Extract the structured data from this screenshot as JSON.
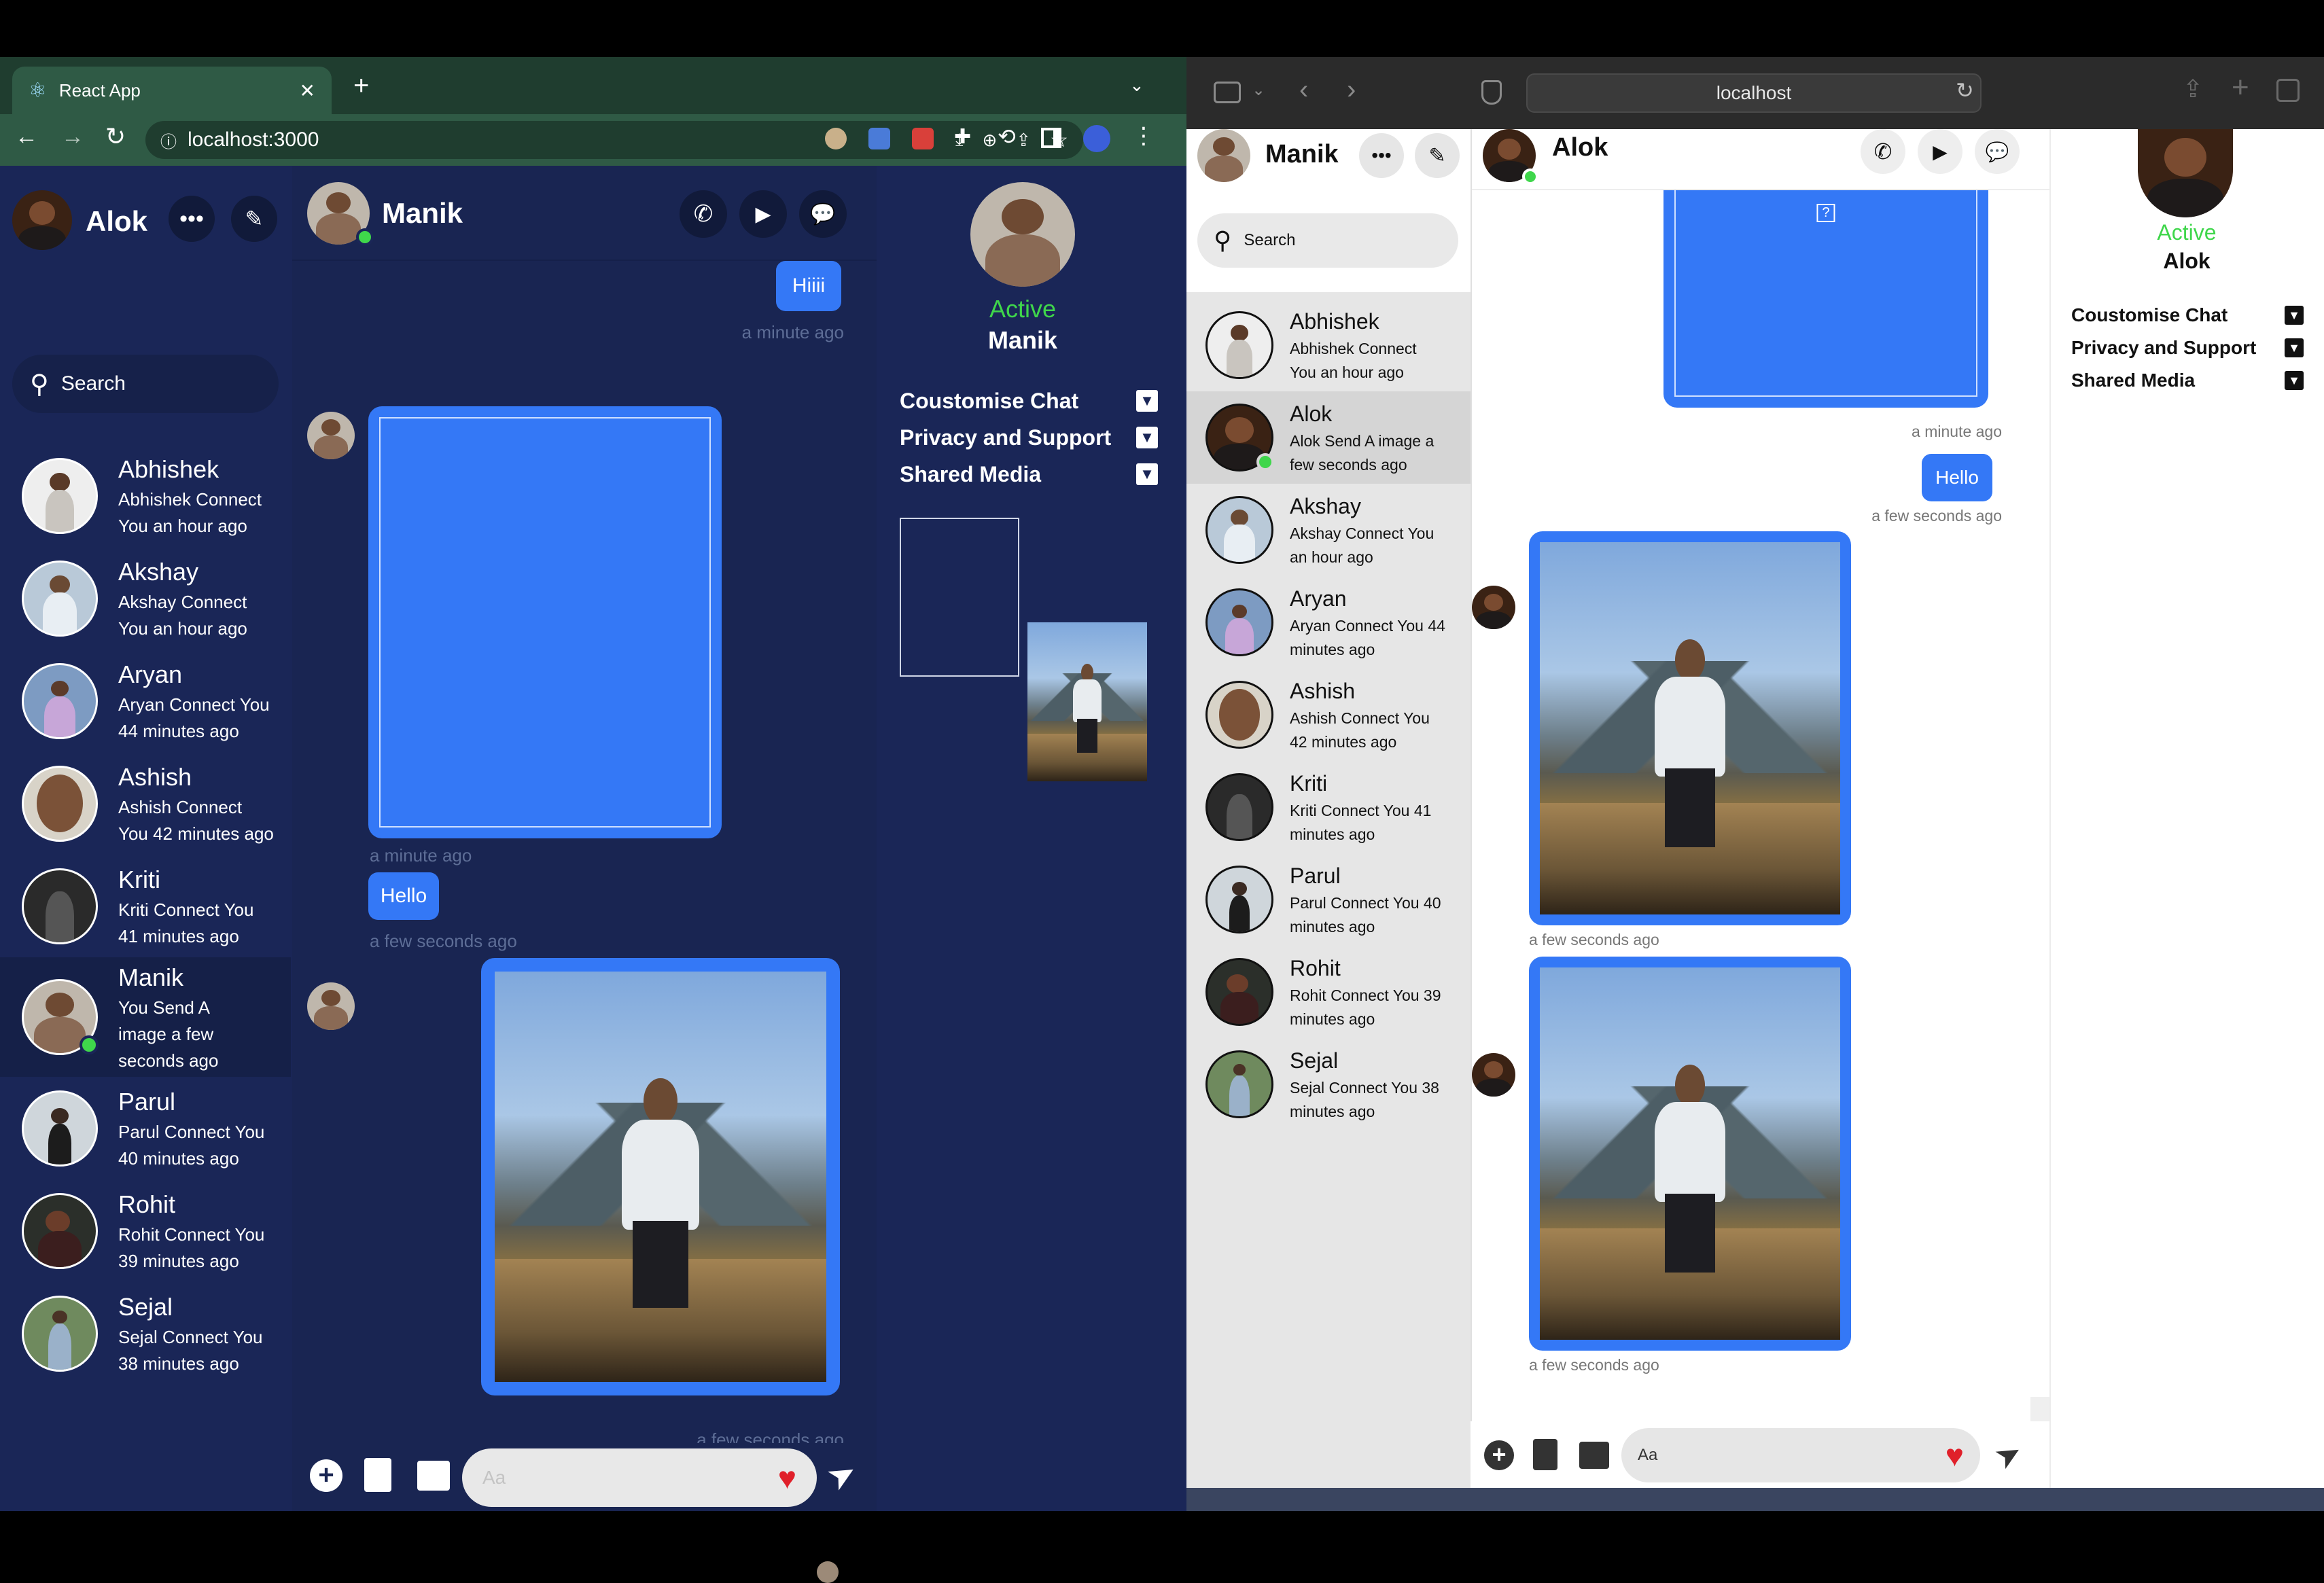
{
  "left": {
    "tab_title": "React App",
    "url": "localhost:3000",
    "user_name": "Alok",
    "search_placeholder": "Search",
    "contacts": [
      {
        "name": "Abhishek",
        "line1": "Abhishek Connect",
        "line2": "You an hour ago"
      },
      {
        "name": "Akshay",
        "line1": "Akshay Connect",
        "line2": "You an hour ago"
      },
      {
        "name": "Aryan",
        "line1": "Aryan Connect You",
        "line2": "44 minutes ago"
      },
      {
        "name": "Ashish",
        "line1": "Ashish Connect",
        "line2": "You 42 minutes ago"
      },
      {
        "name": "Kriti",
        "line1": "Kriti Connect You",
        "line2": "41 minutes ago"
      },
      {
        "name": "Manik",
        "line1": "You Send A",
        "line2": "image a few",
        "line3": "seconds ago"
      },
      {
        "name": "Parul",
        "line1": "Parul Connect You",
        "line2": "40 minutes ago"
      },
      {
        "name": "Rohit",
        "line1": "Rohit Connect You",
        "line2": "39 minutes ago"
      },
      {
        "name": "Sejal",
        "line1": "Sejal Connect You",
        "line2": "38 minutes ago"
      }
    ],
    "chat_name": "Manik",
    "messages": {
      "m1": "Hiiii",
      "t1": "a minute ago",
      "t2": "a minute ago",
      "m2": "Hello",
      "t3": "a few seconds ago",
      "t4": "a few seconds ago"
    },
    "input_placeholder": "Aa",
    "profile": {
      "status": "Active",
      "name": "Manik",
      "options": [
        "Coustomise Chat",
        "Privacy and Support",
        "Shared Media"
      ]
    }
  },
  "right": {
    "url": "localhost",
    "user_name": "Manik",
    "search_placeholder": "Search",
    "contacts": [
      {
        "name": "Abhishek",
        "line1": "Abhishek Connect",
        "line2": "You an hour ago"
      },
      {
        "name": "Alok",
        "line1": "Alok Send A image a",
        "line2": "few seconds ago"
      },
      {
        "name": "Akshay",
        "line1": "Akshay Connect You",
        "line2": "an hour ago"
      },
      {
        "name": "Aryan",
        "line1": "Aryan Connect You 44",
        "line2": "minutes ago"
      },
      {
        "name": "Ashish",
        "line1": "Ashish Connect You",
        "line2": "42 minutes ago"
      },
      {
        "name": "Kriti",
        "line1": "Kriti Connect You 41",
        "line2": "minutes ago"
      },
      {
        "name": "Parul",
        "line1": "Parul Connect You 40",
        "line2": "minutes ago"
      },
      {
        "name": "Rohit",
        "line1": "Rohit Connect You 39",
        "line2": "minutes ago"
      },
      {
        "name": "Sejal",
        "line1": "Sejal Connect You 38",
        "line2": "minutes ago"
      }
    ],
    "chat_name": "Alok",
    "messages": {
      "broken_icon": "?",
      "t1": "a minute ago",
      "m1": "Hello",
      "t2": "a few seconds ago",
      "t3": "a few seconds ago",
      "t4": "a few seconds ago"
    },
    "input_placeholder": "Aa",
    "profile": {
      "status": "Active",
      "name": "Alok",
      "options": [
        "Coustomise Chat",
        "Privacy and Support",
        "Shared Media"
      ]
    }
  },
  "colors": {
    "left_bg": "#1a2657",
    "left_chat_bg": "#192552",
    "bubble": "#3478f6",
    "active_green": "#3fd64b",
    "right_sidebar_bg": "#e6e6e6"
  }
}
